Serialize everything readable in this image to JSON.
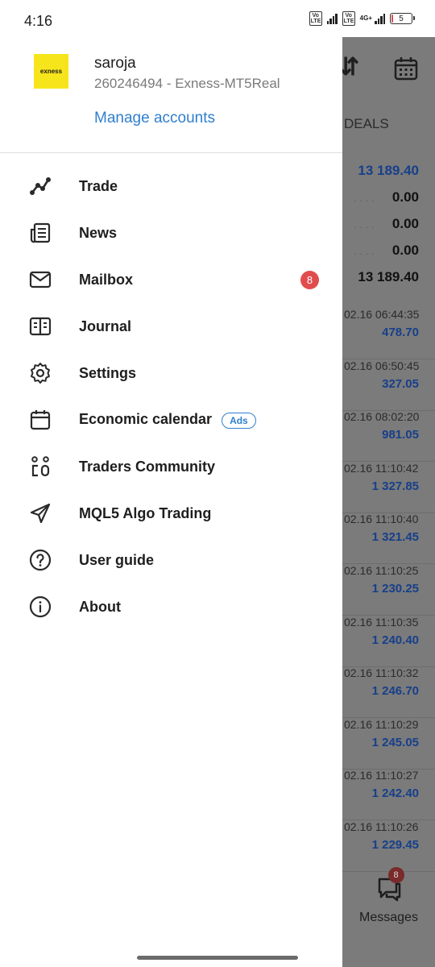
{
  "status_bar": {
    "time": "4:16",
    "volte_label": "Vo LTE",
    "network": "4G+",
    "battery": "5",
    "battery_color": "#e8474a"
  },
  "drawer": {
    "broker_logo_text": "exness",
    "account_name": "saroja",
    "account_number": "260246494 - Exness-MT5Real",
    "manage_accounts": "Manage accounts",
    "menu": [
      {
        "label": "Trade",
        "icon": "trade-chart-icon"
      },
      {
        "label": "News",
        "icon": "news-icon"
      },
      {
        "label": "Mailbox",
        "icon": "mail-icon",
        "badge": "8"
      },
      {
        "label": "Journal",
        "icon": "journal-icon"
      },
      {
        "label": "Settings",
        "icon": "gear-icon"
      },
      {
        "label": "Economic calendar",
        "icon": "calendar-icon",
        "tag": "Ads"
      },
      {
        "label": "Traders Community",
        "icon": "community-icon"
      },
      {
        "label": "MQL5 Algo Trading",
        "icon": "send-icon"
      },
      {
        "label": "User guide",
        "icon": "help-icon"
      },
      {
        "label": "About",
        "icon": "info-icon"
      }
    ]
  },
  "background_app": {
    "deals_tab": "DEALS",
    "summary": [
      "13 189.40",
      "0.00",
      "0.00",
      "0.00",
      "13 189.40"
    ],
    "summary_colors": [
      "#173f8a",
      "#111111",
      "#111111",
      "#111111",
      "#111111"
    ],
    "deals": [
      {
        "time": "02.16 06:44:35",
        "value": "478.70"
      },
      {
        "time": "02.16 06:50:45",
        "value": "327.05"
      },
      {
        "time": "02.16 08:02:20",
        "value": "981.05"
      },
      {
        "time": "02.16 11:10:42",
        "value": "1 327.85"
      },
      {
        "time": "02.16 11:10:40",
        "value": "1 321.45"
      },
      {
        "time": "02.16 11:10:25",
        "value": "1 230.25"
      },
      {
        "time": "02.16 11:10:35",
        "value": "1 240.40"
      },
      {
        "time": "02.16 11:10:32",
        "value": "1 246.70"
      },
      {
        "time": "02.16 11:10:29",
        "value": "1 245.05"
      },
      {
        "time": "02.16 11:10:27",
        "value": "1 242.40"
      },
      {
        "time": "02.16 11:10:26",
        "value": "1 229.45"
      }
    ],
    "messages_label": "Messages",
    "messages_badge": "8"
  }
}
